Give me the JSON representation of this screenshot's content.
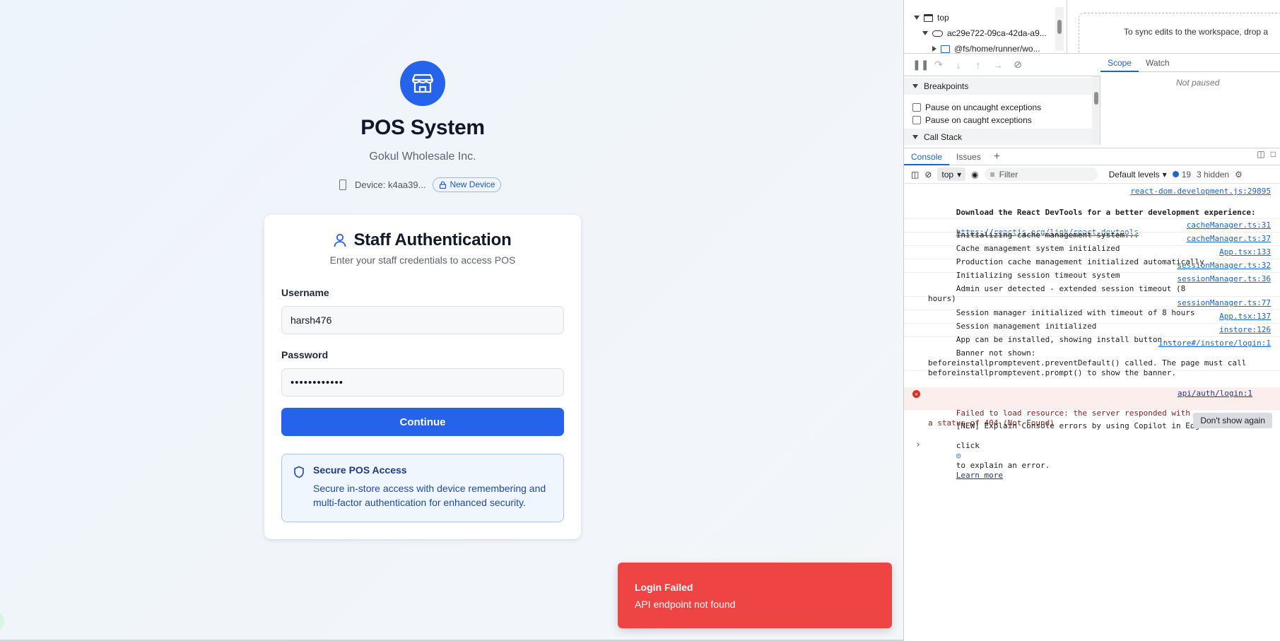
{
  "app": {
    "title": "POS System",
    "subtitle": "Gokul Wholesale Inc.",
    "device_label": "Device: k4aa39...",
    "new_device_label": "New Device",
    "card": {
      "title": "Staff Authentication",
      "subtitle": "Enter your staff credentials to access POS",
      "username_label": "Username",
      "username_value": "harsh476",
      "password_label": "Password",
      "password_value": "••••••••••••",
      "continue_label": "Continue",
      "info_title": "Secure POS Access",
      "info_text": "Secure in-store access with device remembering and multi-factor authentication for enhanced security."
    },
    "toast": {
      "title": "Login Failed",
      "message": "API endpoint not found",
      "color": "#ef4444"
    },
    "accent": "#2563eb"
  },
  "devtools": {
    "tree": {
      "top": "top",
      "origin": "ac29e722-09ca-42da-a9...",
      "folder": "@fs/home/runner/wo..."
    },
    "sync_text": "To sync edits to the workspace, drop a",
    "debug_tabs": [
      "Scope",
      "Watch"
    ],
    "not_paused": "Not paused",
    "breakpoints_label": "Breakpoints",
    "pause_uncaught": "Pause on uncaught exceptions",
    "pause_caught": "Pause on caught exceptions",
    "call_stack_label": "Call Stack",
    "console_tabs": [
      "Console",
      "Issues"
    ],
    "context": "top",
    "filter_placeholder": "Filter",
    "levels": "Default levels",
    "message_count": "19",
    "hidden_count": "3 hidden",
    "logs": [
      {
        "text": "",
        "src": "react-dom.development.js:29895"
      },
      {
        "text": "Download the React DevTools for a better development experience:",
        "link": "https://reactjs.org/link/react-devtools",
        "src": ""
      },
      {
        "text": "Initializing cache management system...",
        "src": "cacheManager.ts:31"
      },
      {
        "text": "Cache management system initialized",
        "src": "cacheManager.ts:37"
      },
      {
        "text": "Production cache management initialized automatically",
        "src": "App.tsx:133"
      },
      {
        "text": "Initializing session timeout system",
        "src": "sessionManager.ts:32"
      },
      {
        "text": "Admin user detected - extended session timeout (8\nhours)",
        "src": "sessionManager.ts:36"
      },
      {
        "text": "Session manager initialized with timeout of 8 hours",
        "src": "sessionManager.ts:77"
      },
      {
        "text": "Session management initialized",
        "src": "App.tsx:137"
      },
      {
        "text": "App can be installed, showing install button...",
        "src": "instore:126"
      },
      {
        "text": "Banner not shown:\nbeforeinstallpromptevent.preventDefault() called. The page must call\nbeforeinstallpromptevent.prompt() to show the banner.",
        "src": "instore#/instore/login:1"
      }
    ],
    "error": {
      "text": "Failed to load resource: the server responded with\na status of 404 (Not Found)",
      "src": "api/auth/login:1"
    },
    "explain": {
      "line1": "[NEW] Explain Console errors by using Copilot in Edge:",
      "line2_pre": "click",
      "line2_post": "to explain an error.",
      "learn_more": "Learn more",
      "dont_show": "Don't show again"
    }
  }
}
